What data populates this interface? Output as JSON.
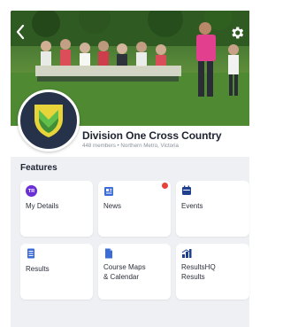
{
  "hero": {
    "back_icon": "chevron-left-icon",
    "settings_icon": "gear-icon"
  },
  "club": {
    "name": "Division One Cross Country",
    "meta": "448 members • Northern Metro, Victoria",
    "logo_colors": {
      "badge": "#26324a",
      "shield_yellow": "#e7d33a",
      "shield_green": "#5fbf4a"
    }
  },
  "features": {
    "title": "Features",
    "tiles": [
      {
        "label": "My Details",
        "icon": "initials-avatar-icon",
        "initials": "TR",
        "accent": "#6b2fd6"
      },
      {
        "label": "News",
        "icon": "news-icon",
        "accent": "#3a6bd6",
        "has_notification": true
      },
      {
        "label": "Events",
        "icon": "calendar-icon",
        "accent": "#1f3f8f"
      },
      {
        "label": "Results",
        "icon": "document-icon",
        "accent": "#3a6bd6"
      },
      {
        "label": "Course Maps\n& Calendar",
        "label_line1": "Course Maps",
        "label_line2": "& Calendar",
        "icon": "file-icon",
        "accent": "#3a6bd6"
      },
      {
        "label_line1": "ResultsHQ",
        "label_line2": "Results",
        "icon": "results-hq-icon",
        "accent": "#1f3f8f"
      }
    ]
  },
  "colors": {
    "notification": "#e8403a",
    "panel_bg": "#eef0f4"
  }
}
